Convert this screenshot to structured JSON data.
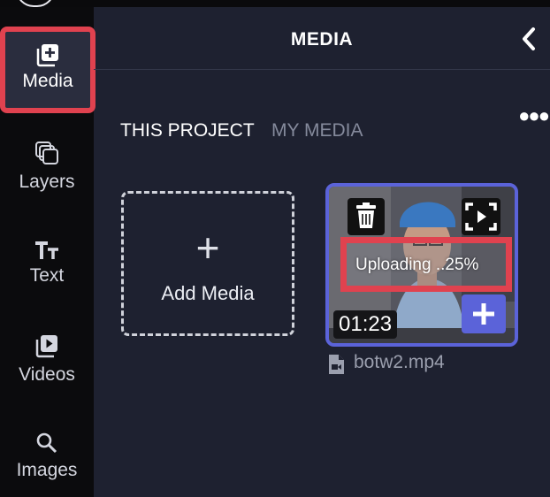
{
  "sidebar": {
    "items": [
      {
        "label": "Media",
        "icon": "add-media-icon",
        "active": true
      },
      {
        "label": "Layers",
        "icon": "layers-icon"
      },
      {
        "label": "Text",
        "icon": "text-icon"
      },
      {
        "label": "Videos",
        "icon": "video-library-icon"
      },
      {
        "label": "Images",
        "icon": "search-icon"
      }
    ]
  },
  "header": {
    "title": "MEDIA"
  },
  "tabs": [
    {
      "label": "THIS PROJECT",
      "active": true
    },
    {
      "label": "MY MEDIA",
      "active": false
    }
  ],
  "add_media": {
    "plus": "+",
    "label": "Add Media"
  },
  "media_card": {
    "upload_status": "Uploading ..25%",
    "upload_progress_percent": 25,
    "duration": "01:23",
    "filename": "botw2.mp4"
  },
  "colors": {
    "accent": "#5b63d9",
    "highlight": "#e0424f",
    "panel_bg": "#1e2130",
    "sidebar_bg": "#0b0b0d"
  }
}
